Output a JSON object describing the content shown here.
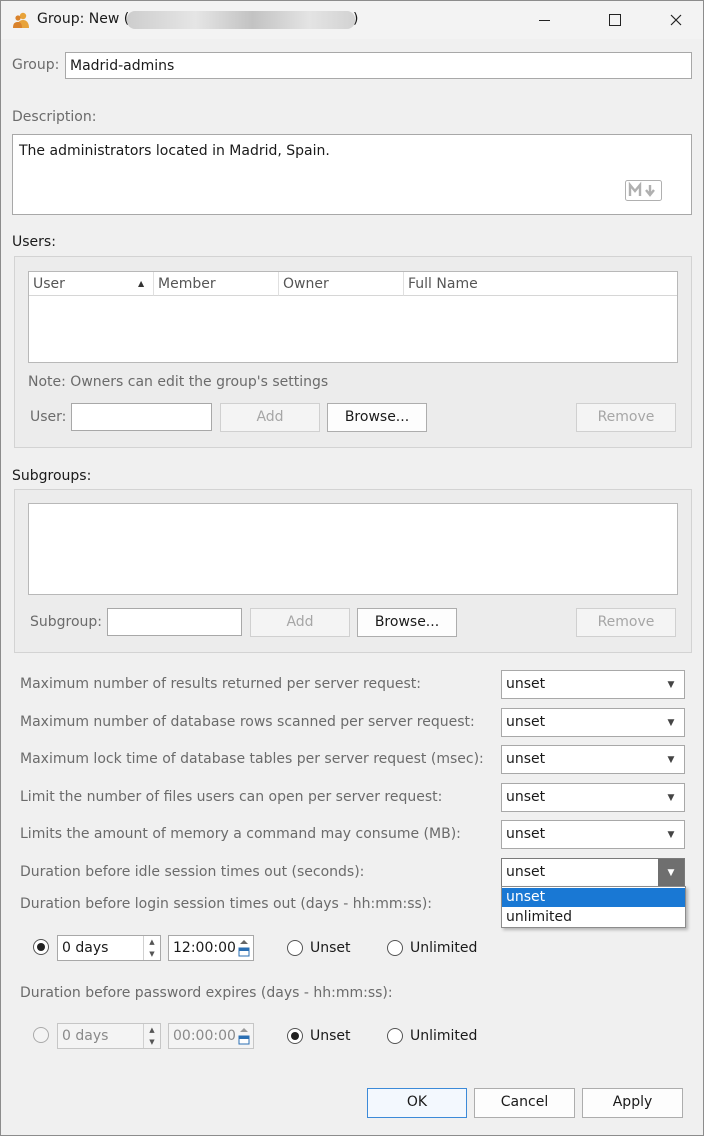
{
  "window": {
    "title": "Group: New (",
    "title_suffix": ")"
  },
  "group": {
    "label": "Group:",
    "value": "Madrid-admins"
  },
  "description": {
    "label": "Description:",
    "value": "The administrators located in Madrid, Spain."
  },
  "users": {
    "label": "Users:",
    "columns": [
      "User",
      "Member",
      "Owner",
      "Full Name"
    ],
    "note": "Note: Owners can edit the group's settings",
    "field_label": "User:",
    "add": "Add",
    "browse": "Browse...",
    "remove": "Remove"
  },
  "subgroups": {
    "label": "Subgroups:",
    "field_label": "Subgroup:",
    "add": "Add",
    "browse": "Browse...",
    "remove": "Remove"
  },
  "limits": [
    {
      "label": "Maximum number of results returned per server request:",
      "value": "unset"
    },
    {
      "label": "Maximum number of database rows scanned per server request:",
      "value": "unset"
    },
    {
      "label": "Maximum lock time of database tables per server request (msec):",
      "value": "unset"
    },
    {
      "label": "Limit the number of files users can open per server request:",
      "value": "unset"
    },
    {
      "label": "Limits the amount of memory a command may consume (MB):",
      "value": "unset"
    },
    {
      "label": "Duration before idle session times out (seconds):",
      "value": "unset"
    }
  ],
  "dropdown_options": [
    "unset",
    "unlimited"
  ],
  "login_timeout": {
    "label": "Duration before login session times out (days - hh:mm:ss):",
    "days": "0 days",
    "time": "12:00:00",
    "unset": "Unset",
    "unlimited": "Unlimited"
  },
  "password_expiry": {
    "label": "Duration before password expires (days - hh:mm:ss):",
    "days": "0 days",
    "time": "00:00:00",
    "unset": "Unset",
    "unlimited": "Unlimited"
  },
  "footer": {
    "ok": "OK",
    "cancel": "Cancel",
    "apply": "Apply"
  },
  "colors": {
    "accent": "#1978d4",
    "default_button_border": "#3c8ad8"
  }
}
